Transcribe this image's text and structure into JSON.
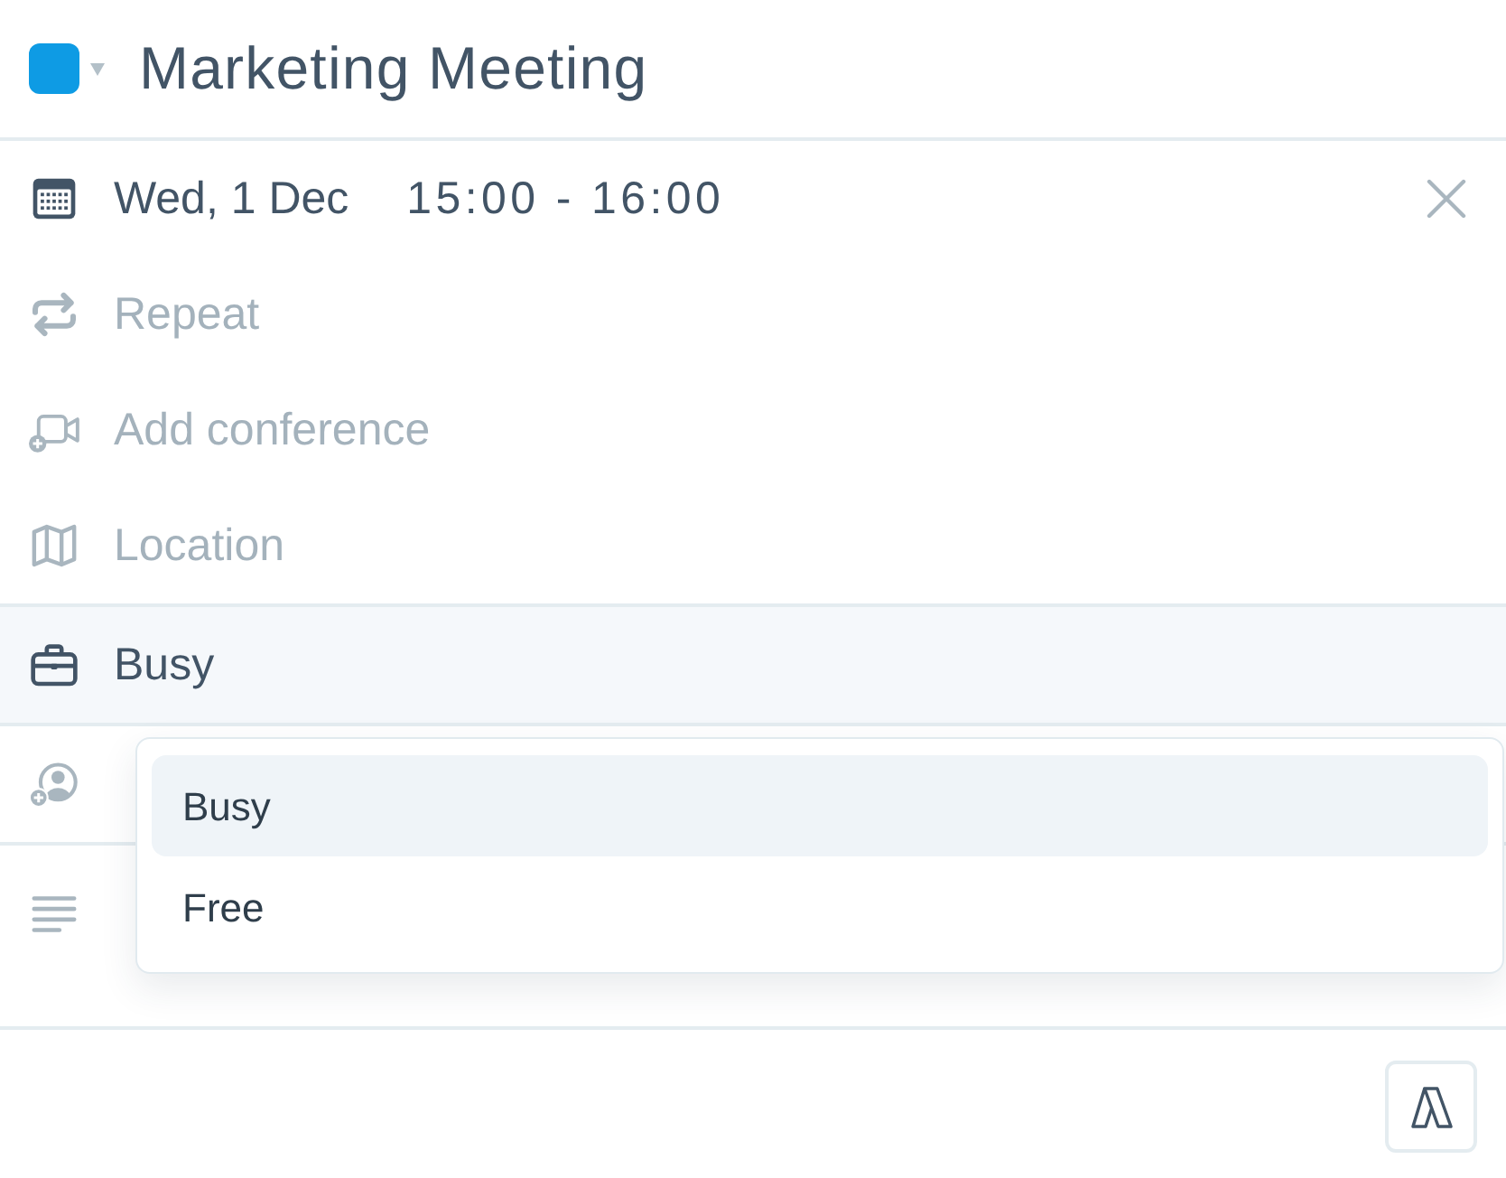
{
  "header": {
    "title": "Marketing Meeting"
  },
  "rows": [
    {
      "kind": "date",
      "date": "Wed, 1 Dec",
      "time": "15:00 - 16:00"
    },
    {
      "kind": "repeat",
      "placeholder": "Repeat"
    },
    {
      "kind": "conference",
      "placeholder": "Add conference"
    },
    {
      "kind": "location",
      "placeholder": "Location"
    },
    {
      "kind": "availability",
      "value": "Busy",
      "expanded": true
    },
    {
      "kind": "attendees"
    },
    {
      "kind": "description"
    }
  ],
  "menu": {
    "items": [
      {
        "label": "Busy",
        "selected": true
      },
      {
        "label": "Free",
        "selected": false
      }
    ]
  }
}
